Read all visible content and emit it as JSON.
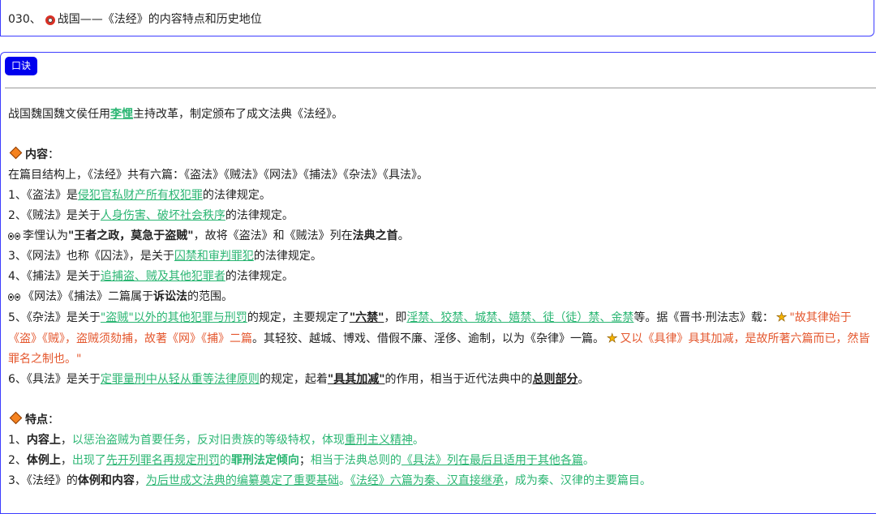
{
  "header": {
    "prefix": "030、",
    "title": "战国——《法经》的内容特点和历史地位"
  },
  "button": {
    "label": "口诀"
  },
  "intro": {
    "a": "战国魏国魏文侯任用",
    "name": "李悝",
    "b": "主持改革，制定颁布了成文法典《法经》。"
  },
  "content": {
    "heading": "内容",
    "colon": "：",
    "structure": "在篇目结构上，《法经》共有六篇：《盗法》《贼法》《网法》《捕法》《杂法》《具法》。",
    "item1": {
      "a": "1、《盗法》是",
      "link": "侵犯官私财产所有权犯罪",
      "b": "的法律规定。"
    },
    "item2": {
      "a": "2、《贼法》是关于",
      "link": "人身伤害、破坏社会秩序",
      "b": "的法律规定。"
    },
    "note1": {
      "a": "李悝认为",
      "quote": "\"王者之政，莫急于盗贼\"",
      "b": "，故将《盗法》和《贼法》列在",
      "bold": "法典之首",
      "c": "。"
    },
    "item3": {
      "a": "3、《网法》也称《囚法》，是关于",
      "link": "囚禁和审判罪犯",
      "b": "的法律规定。"
    },
    "item4": {
      "a": "4、《捕法》是关于",
      "link": "追捕盗、贼及其他犯罪者",
      "b": "的法律规定。"
    },
    "note2": {
      "a": "《网法》《捕法》二篇属于",
      "bold": "诉讼法",
      "b": "的范围。"
    },
    "item5": {
      "a": "5、《杂法》是关于",
      "link": "\"盗贼\"以外的其他犯罪与刑罚",
      "b": "的规定，主要规定了",
      "bold": "\"六禁\"",
      "c": "，即",
      "link2": "淫禁、狡禁、城禁、嬉禁、徒（徒）禁、金禁",
      "d": "等。据《晋书·刑法志》载：",
      "quote1": "\"故其律始于《盗》《贼》，盗贼须劾捕，故著《网》《捕》二篇",
      "e": "。其轻狡、越城、博戏、借假不廉、淫侈、逾制，以为《杂律》一篇。",
      "quote2": "又以《具律》具其加减，是故所著六篇而已，然皆罪名之制也。\""
    },
    "item6": {
      "a": "6、《具法》是关于",
      "link": "定罪量刑中从轻从重等法律原则",
      "b": "的规定，起着",
      "bold": "\"具其加减\"",
      "c": "的作用，相当于近代法典中的",
      "bold2": "总则部分",
      "d": "。"
    }
  },
  "features": {
    "heading": "特点",
    "colon": "：",
    "f1": {
      "a": "1、",
      "bold": "内容上",
      "b": "，",
      "g1": "以惩治盗贼为首要任务，反对旧贵族的等级特权，体现",
      "link": "重刑主义精神",
      "g2": "。"
    },
    "f2": {
      "a": "2、",
      "bold": "体例上",
      "b": "，",
      "g1": "出现了",
      "link": "先开列罪名再规定刑罚",
      "g2": "的",
      "gbold": "罪刑法定倾向",
      "c": "；",
      "g3": "相当于法典总则的",
      "link2": "《具法》列在最后且适用于其他各篇",
      "g4": "。"
    },
    "f3": {
      "a": "3、《法经》的",
      "bold": "体例和内容",
      "b": "，",
      "link": "为后世成文法典的编纂奠定了重要基础",
      "g1": "。",
      "link2": "《法经》六篇为秦、汉直接继承",
      "g2": "，成为秦、汉律的主要篇目。"
    }
  },
  "icons": {
    "ring": "ring-icon",
    "diamond": "diamond-icon",
    "eyes": "eyes-icon",
    "star": "star-icon"
  },
  "colors": {
    "accent": "#2bb673",
    "quote": "#e4572e",
    "button": "#0000ee",
    "border": "#3d3dff"
  }
}
